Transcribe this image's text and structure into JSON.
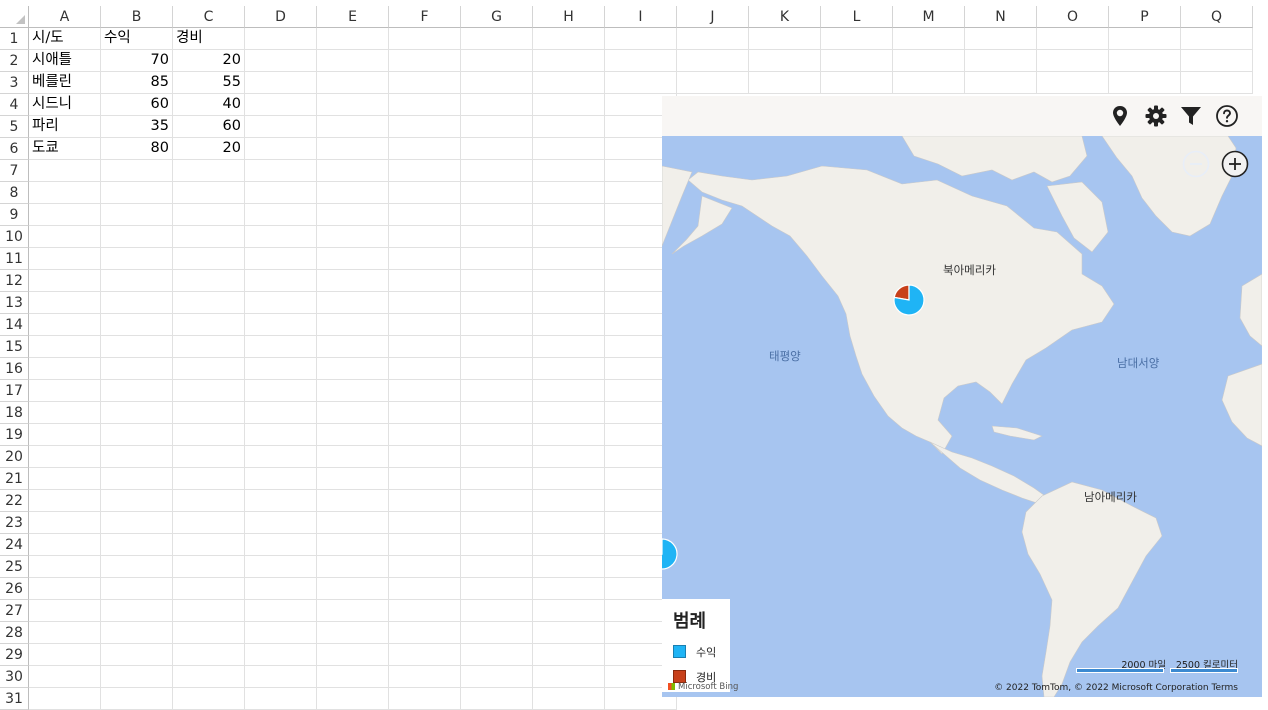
{
  "columns": [
    "A",
    "B",
    "C",
    "D",
    "E",
    "F",
    "G",
    "H",
    "I",
    "J",
    "K",
    "L",
    "M",
    "N",
    "O",
    "P",
    "Q"
  ],
  "rows": [
    "1",
    "2",
    "3",
    "4",
    "5",
    "6",
    "7",
    "8",
    "9",
    "10",
    "11",
    "12",
    "13",
    "14",
    "15",
    "16",
    "17",
    "18",
    "19",
    "20",
    "21",
    "22",
    "23",
    "24",
    "25",
    "26",
    "27",
    "28",
    "29",
    "30",
    "31"
  ],
  "table": {
    "headers": [
      "시/도",
      "수익",
      "경비"
    ],
    "data": [
      {
        "city": "시애틀",
        "revenue": "70",
        "expense": "20"
      },
      {
        "city": "베를린",
        "revenue": "85",
        "expense": "55"
      },
      {
        "city": "시드니",
        "revenue": "60",
        "expense": "40"
      },
      {
        "city": "파리",
        "revenue": "35",
        "expense": "60"
      },
      {
        "city": "도쿄",
        "revenue": "80",
        "expense": "20"
      }
    ]
  },
  "map": {
    "toolbar": [
      "pin-icon",
      "gear-icon",
      "filter-icon",
      "help-icon"
    ],
    "labels": {
      "north_america": "북아메리카",
      "south_america": "남아메리카",
      "pacific": "태평양",
      "atlantic": "남대서양"
    },
    "legend": {
      "title": "범례",
      "items": [
        {
          "name": "수익",
          "color": "#1fb4f5"
        },
        {
          "name": "경비",
          "color": "#c8401a"
        }
      ]
    },
    "scale": {
      "miles": "2000 마일",
      "km": "2500 킬로미터"
    },
    "attribution": "© 2022 TomTom, © 2022 Microsoft Corporation  Terms",
    "provider": "Microsoft Bing",
    "colors": {
      "ocean": "#a7c5f0",
      "land": "#f1efea",
      "toolbar": "#f8f6f4"
    }
  }
}
